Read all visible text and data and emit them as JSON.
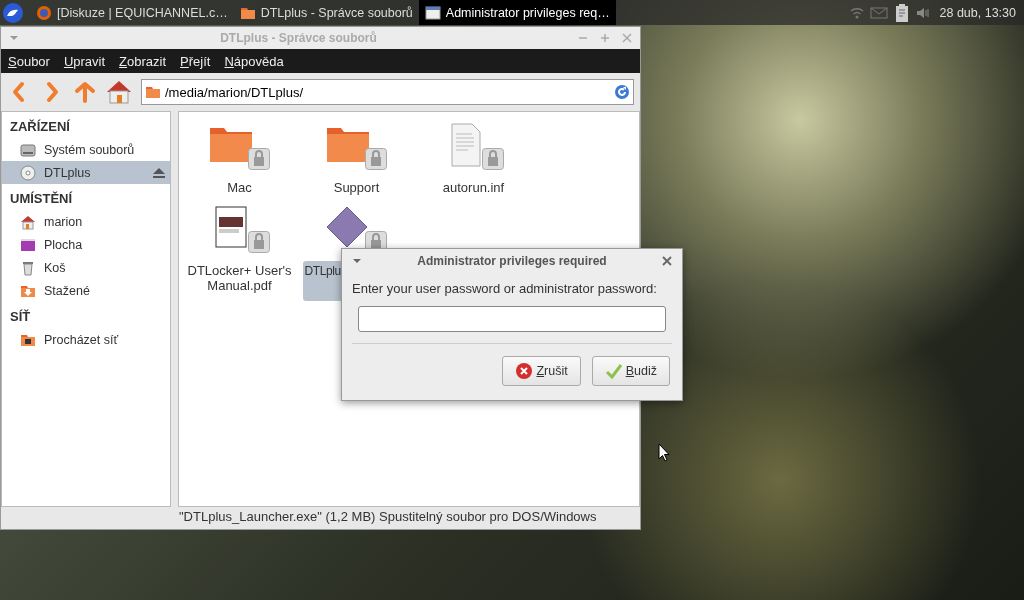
{
  "panel": {
    "tasks": [
      {
        "label": "[Diskuze | EQUICHANNEL.c…",
        "kind": "browser",
        "selected": false
      },
      {
        "label": "DTLplus - Správce souborů",
        "kind": "folder",
        "selected": false
      },
      {
        "label": "Administrator privileges req…",
        "kind": "window",
        "selected": true
      }
    ],
    "clock": "28 dub, 13:30"
  },
  "window": {
    "title": "DTLplus - Správce souborů",
    "menu": [
      "Soubor",
      "Upravit",
      "Zobrazit",
      "Přejít",
      "Nápověda"
    ],
    "location": "/media/marion/DTLplus/",
    "sidebar": [
      {
        "heading": "ZAŘÍZENÍ",
        "items": [
          {
            "label": "Systém souborů",
            "kind": "drive",
            "selected": false
          },
          {
            "label": "DTLplus",
            "kind": "disc",
            "selected": true,
            "ejectable": true
          }
        ]
      },
      {
        "heading": "UMÍSTĚNÍ",
        "items": [
          {
            "label": "marion",
            "kind": "home",
            "selected": false
          },
          {
            "label": "Plocha",
            "kind": "desktop",
            "selected": false
          },
          {
            "label": "Koš",
            "kind": "trash",
            "selected": false
          },
          {
            "label": "Stažené",
            "kind": "downloads",
            "selected": false
          }
        ]
      },
      {
        "heading": "SÍŤ",
        "items": [
          {
            "label": "Procházet síť",
            "kind": "network",
            "selected": false
          }
        ]
      }
    ],
    "files": [
      {
        "name": "Mac",
        "kind": "folder",
        "locked": true,
        "selected": false
      },
      {
        "name": "Support",
        "kind": "folder",
        "locked": true,
        "selected": false
      },
      {
        "name": "autorun.inf",
        "kind": "text",
        "locked": true,
        "selected": false
      },
      {
        "name": "DTLocker+ User's Manual.pdf",
        "kind": "pdf",
        "locked": true,
        "selected": false
      },
      {
        "name": "DTLplu",
        "kind": "executable",
        "locked": true,
        "selected": true
      }
    ],
    "status_bar": "\"DTLplus_Launcher.exe\" (1,2 MB) Spustitelný soubor pro DOS/Windows"
  },
  "dialog": {
    "title": "Administrator privileges required",
    "prompt": "Enter your user password or administrator password:",
    "buttons": [
      {
        "label": "Zrušit",
        "kind": "cancel"
      },
      {
        "label": "Budiž",
        "kind": "ok"
      }
    ]
  }
}
